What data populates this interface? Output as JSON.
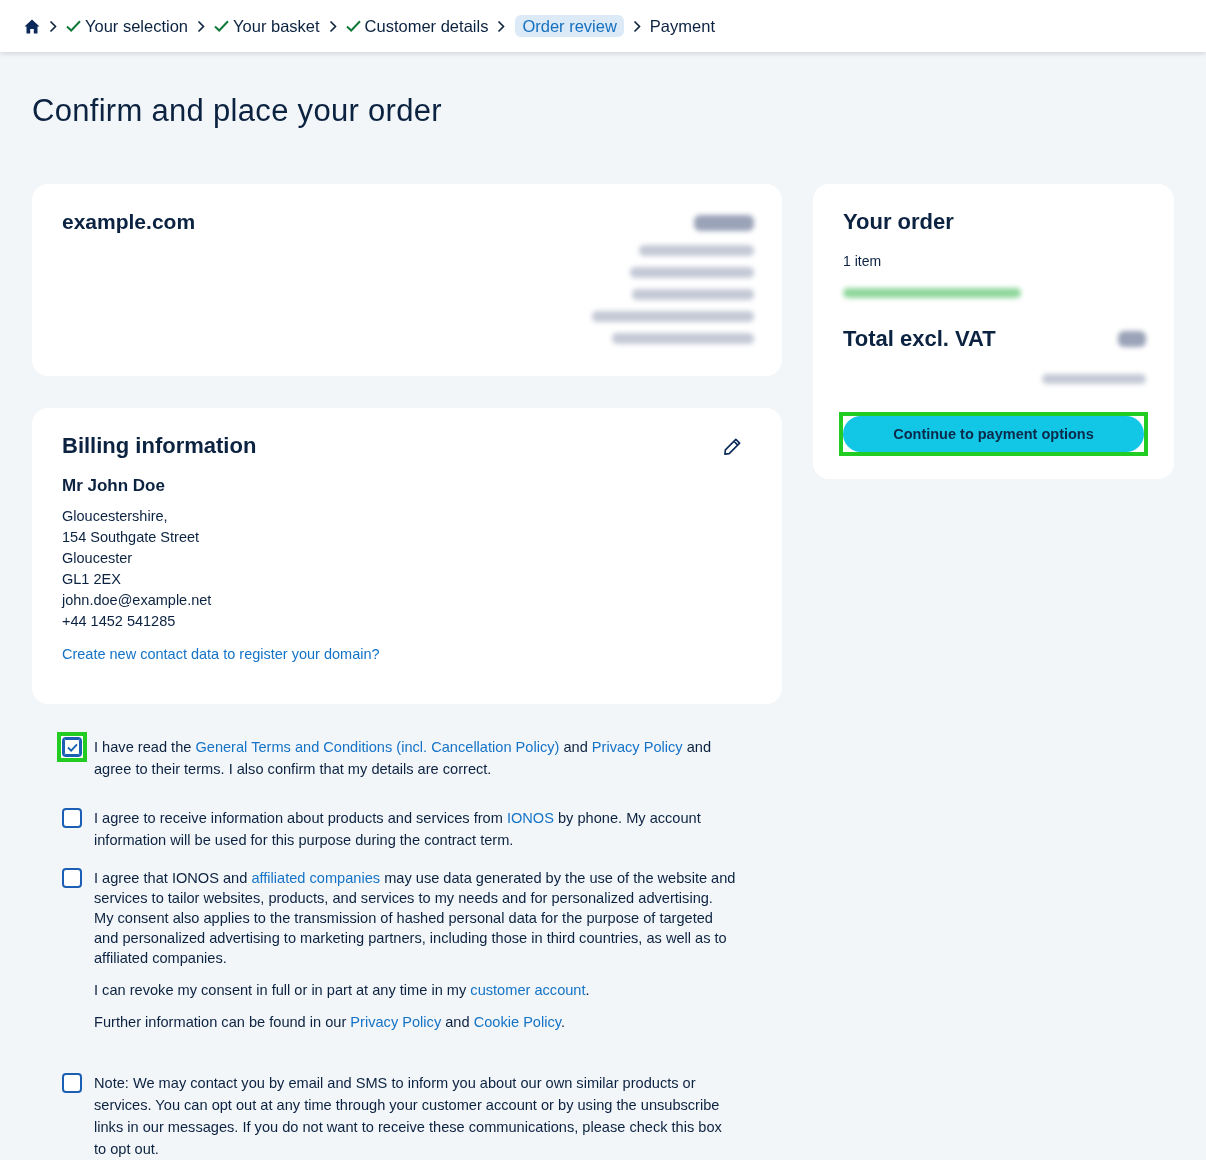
{
  "breadcrumb": {
    "steps": [
      {
        "label": "Your selection",
        "done": true,
        "selected": false
      },
      {
        "label": "Your basket",
        "done": true,
        "selected": false
      },
      {
        "label": "Customer details",
        "done": true,
        "selected": false
      },
      {
        "label": "Order review",
        "done": false,
        "selected": true
      },
      {
        "label": "Payment",
        "done": false,
        "selected": false
      }
    ]
  },
  "page_title": "Confirm and place your order",
  "product": {
    "domain": "example.com",
    "details": [
      {
        "kind": "price"
      },
      {
        "kind": "text"
      },
      {
        "kind": "text"
      },
      {
        "kind": "text"
      },
      {
        "kind": "text"
      },
      {
        "kind": "text"
      }
    ]
  },
  "billing": {
    "title": "Billing information",
    "name": "Mr John Doe",
    "address_lines": [
      "Gloucestershire,",
      "154 Southgate Street",
      "Gloucester",
      "GL1 2EX",
      "john.doe@example.net",
      "+44 1452 541285"
    ],
    "link": "Create new contact data to register your domain?"
  },
  "consents": [
    {
      "checked": true,
      "highlighted": true,
      "paragraphs": [
        [
          {
            "text": "I have read the ",
            "link": false
          },
          {
            "text": "General Terms and Conditions (incl. Cancellation Policy)",
            "link": true
          },
          {
            "text": " and ",
            "link": false
          },
          {
            "text": "Privacy Policy",
            "link": true
          },
          {
            "text": " and agree to their terms. I also confirm that my details are correct.",
            "link": false
          }
        ]
      ]
    },
    {
      "checked": false,
      "highlighted": false,
      "paragraphs": [
        [
          {
            "text": "I agree to receive information about products and services from ",
            "link": false
          },
          {
            "text": "IONOS",
            "link": true
          },
          {
            "text": " by phone. My account information will be used for this purpose during the contract term.",
            "link": false
          }
        ]
      ]
    },
    {
      "checked": false,
      "highlighted": false,
      "paragraphs": [
        [
          {
            "text": "I agree that IONOS and ",
            "link": false
          },
          {
            "text": "affiliated companies",
            "link": true
          },
          {
            "text": " may use data generated by the use of the website and services to tailor websites, products, and services to my needs and for personalized advertising. My consent also applies to the transmission of hashed personal data for the purpose of targeted and personalized advertising to marketing partners, including those in third countries, as well as to affiliated companies.",
            "link": false
          }
        ],
        [
          {
            "text": "I can revoke my consent in full or in part at any time in my ",
            "link": false
          },
          {
            "text": "customer account",
            "link": true
          },
          {
            "text": ".",
            "link": false
          }
        ],
        [
          {
            "text": "Further information can be found in our ",
            "link": false
          },
          {
            "text": "Privacy Policy",
            "link": true
          },
          {
            "text": " and ",
            "link": false
          },
          {
            "text": "Cookie Policy",
            "link": true
          },
          {
            "text": ".",
            "link": false
          }
        ]
      ]
    },
    {
      "checked": false,
      "highlighted": false,
      "paragraphs": [
        [
          {
            "text": "Note: We may contact you by email and SMS to inform you about our own similar products or services. You can opt out at any time through your customer account or by using the unsubscribe links in our messages. If you do not want to receive these communications, please check this box to opt out.",
            "link": false
          }
        ]
      ]
    }
  ],
  "order_summary": {
    "title": "Your order",
    "item_count": "1 item",
    "savings": {
      "kind": "blurred"
    },
    "total_label": "Total excl. VAT",
    "total_value": {
      "kind": "blurred"
    },
    "total_note": {
      "kind": "blurred"
    },
    "button": {
      "label": "Continue to payment options",
      "highlighted": true
    }
  }
}
